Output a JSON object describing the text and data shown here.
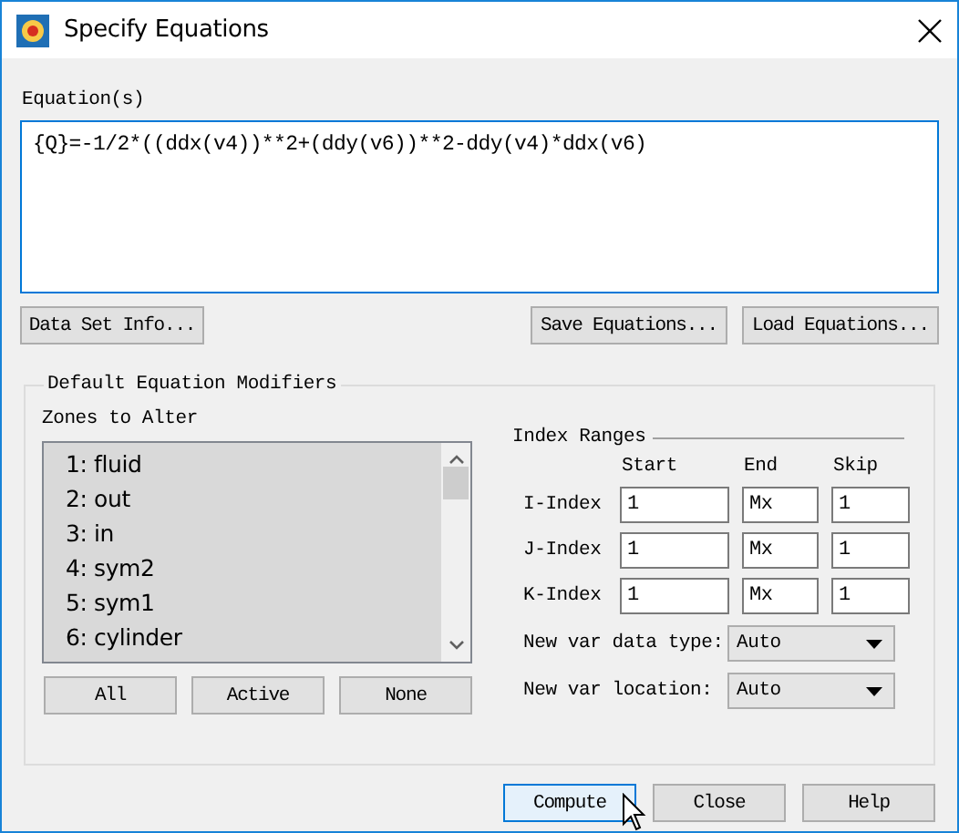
{
  "window": {
    "title": "Specify Equations"
  },
  "equations": {
    "label": "Equation(s)",
    "value": "{Q}=-1/2*((ddx(v4))**2+(ddy(v6))**2-ddy(v4)*ddx(v6)"
  },
  "equation_buttons": [
    "Data Set Info...",
    "Save Equations...",
    "Load Equations..."
  ],
  "modifiers": {
    "title": "Default Equation Modifiers",
    "zones": {
      "label": "Zones to Alter",
      "items": [
        {
          "label": "1: fluid",
          "selected": true
        },
        {
          "label": "2: out",
          "selected": true
        },
        {
          "label": "3: in",
          "selected": true
        },
        {
          "label": "4: sym2",
          "selected": true
        },
        {
          "label": "5: sym1",
          "selected": true
        },
        {
          "label": "6: cylinder",
          "selected": true
        }
      ],
      "buttons": [
        "All",
        "Active",
        "None"
      ]
    },
    "index_ranges": {
      "title": "Index Ranges",
      "columns": [
        "Start",
        "End",
        "Skip"
      ],
      "rows": [
        {
          "label": "I-Index",
          "start": "1",
          "end": "Mx",
          "skip": "1"
        },
        {
          "label": "J-Index",
          "start": "1",
          "end": "Mx",
          "skip": "1"
        },
        {
          "label": "K-Index",
          "start": "1",
          "end": "Mx",
          "skip": "1"
        }
      ]
    },
    "dropdowns": [
      {
        "label": "New var data type:",
        "value": "Auto"
      },
      {
        "label": "New var location:",
        "value": "Auto"
      }
    ]
  },
  "buttons": [
    {
      "label": "Compute",
      "focused": true
    },
    {
      "label": "Close",
      "focused": false
    },
    {
      "label": "Help",
      "focused": false
    }
  ]
}
